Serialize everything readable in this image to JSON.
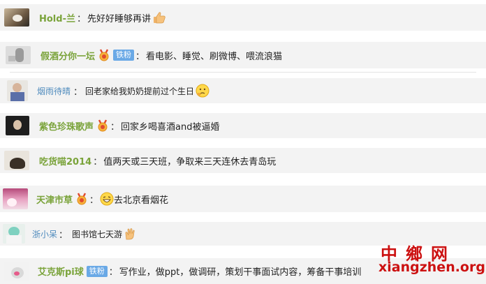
{
  "comments": [
    {
      "name": "Hold-兰",
      "sep": "：",
      "text": "先好好睡够再讲"
    },
    {
      "name": "假酒分你一坛",
      "badge": "铁粉",
      "sep": "：",
      "text": "看电影、睡觉、刷微博、喂流浪猫"
    },
    {
      "name": "烟雨待晴",
      "sep": "：",
      "text": "回老家给我奶奶提前过个生日"
    },
    {
      "name": "紫色珍珠歌声",
      "sep": "：",
      "text": "回家乡喝喜酒and被逼婚"
    },
    {
      "name": "吃货喵2014",
      "sep": "：",
      "text": "值两天或三天班，争取来三天连休去青岛玩"
    },
    {
      "name": "天津市草",
      "sep": "：",
      "text": "去北京看烟花"
    },
    {
      "name": "浙小呆",
      "sep": "：",
      "text": "图书馆七天游"
    },
    {
      "name": "艾克斯pi球",
      "badge": "铁粉",
      "sep": "：",
      "text": "写作业，做ppt，做调研，策划干事面试内容，筹备干事培训"
    }
  ],
  "watermark": {
    "cn": "中鄉网",
    "en": "xiangzhen.org"
  },
  "colors": {
    "name_green": "#7aa33a",
    "name_blue": "#4f8bbd",
    "badge_blue": "#6aa9e6",
    "row_bg": "#f3f3f3",
    "watermark_red": "#cc1111"
  },
  "icons": [
    "thumbs-up-emoji",
    "medal-icon",
    "thinking-emoji",
    "laughing-emoji",
    "clapping-hands-emoji"
  ]
}
